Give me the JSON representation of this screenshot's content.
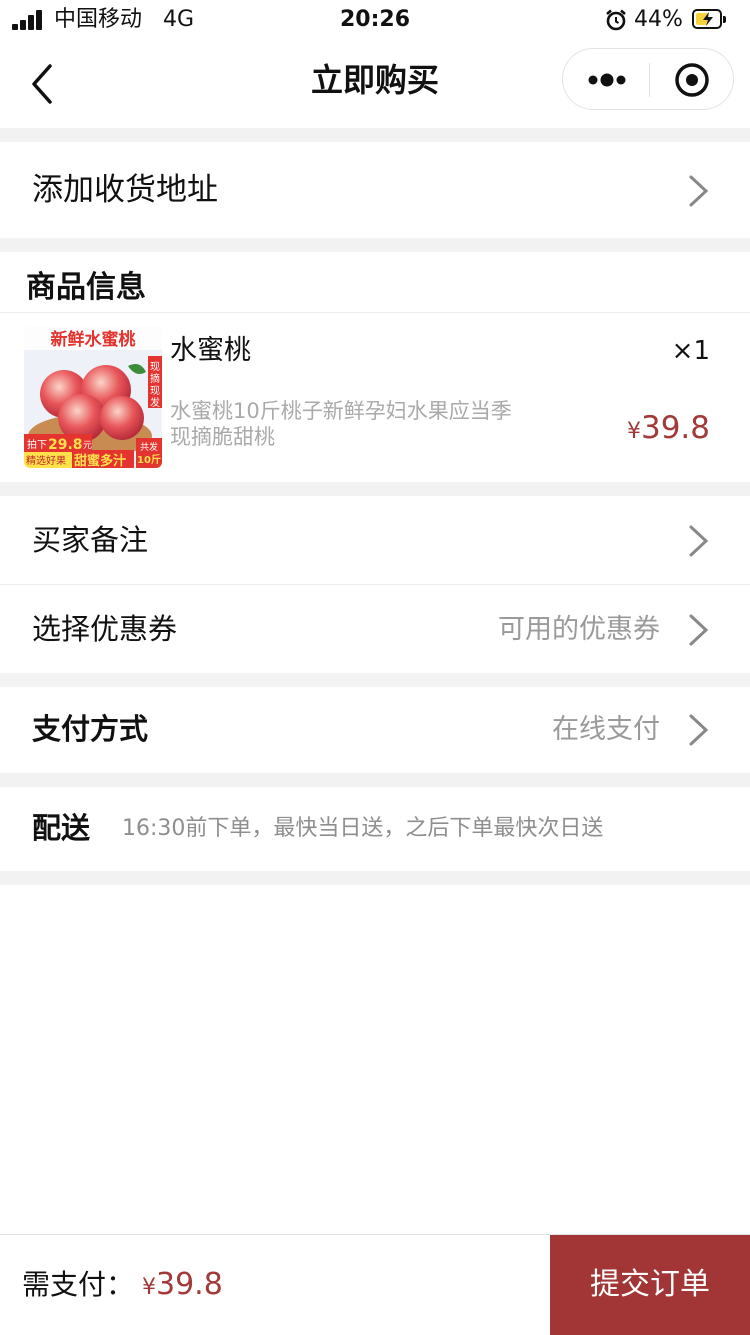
{
  "status": {
    "carrier": "中国移动",
    "network": "4G",
    "time": "20:26",
    "battery": "44%"
  },
  "nav": {
    "title": "立即购买"
  },
  "address": {
    "label": "添加收货地址"
  },
  "product_section": {
    "title": "商品信息",
    "item": {
      "name": "水蜜桃",
      "quantity": "×1",
      "description": "水蜜桃10斤桃子新鲜孕妇水果应当季现摘脆甜桃",
      "currency": "¥",
      "price": "39.8",
      "image_text": {
        "banner": "新鲜水蜜桃",
        "side": "现摘现发",
        "promo_prefix": "拍下",
        "promo_price": "29.8",
        "promo_unit": "元",
        "tagline1": "精选好果",
        "tagline2": "甜蜜多汁",
        "weight_prefix": "共发",
        "weight": "10斤"
      }
    }
  },
  "remarks": {
    "label": "买家备注"
  },
  "coupon": {
    "label": "选择优惠券",
    "value": "可用的优惠券"
  },
  "payment": {
    "label": "支付方式",
    "value": "在线支付"
  },
  "delivery": {
    "label": "配送",
    "text": "16:30前下单，最快当日送，之后下单最快次日送"
  },
  "footer": {
    "pay_label": "需支付：",
    "currency": "¥",
    "amount": "39.8",
    "submit_label": "提交订单"
  },
  "colors": {
    "accent": "#a23535",
    "price": "#a23a3a",
    "gap": "#f2f2f2"
  }
}
